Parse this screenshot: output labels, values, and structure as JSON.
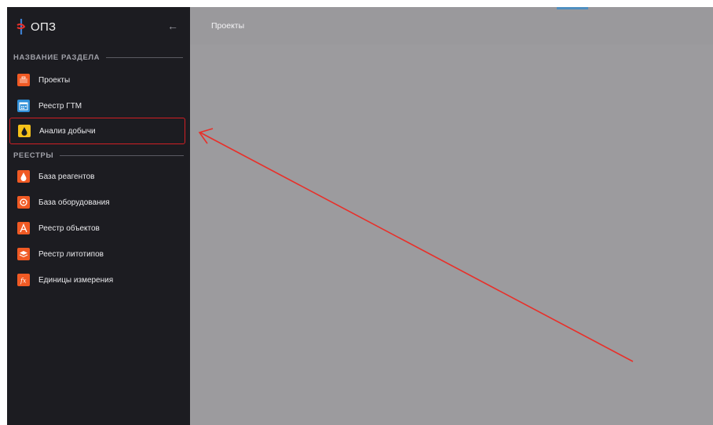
{
  "app": {
    "title": "ОПЗ",
    "collapse_icon": "arrow-left-icon"
  },
  "header": {
    "breadcrumb": "Проекты"
  },
  "sidebar": {
    "sections": [
      {
        "title": "НАЗВАНИЕ РАЗДЕЛА",
        "items": [
          {
            "label": "Проекты",
            "icon": "briefcase-icon",
            "color": "#f05a24"
          },
          {
            "label": "Реестр ГТМ",
            "icon": "calendar-icon",
            "color": "#2f8fd8"
          },
          {
            "label": "Анализ добычи",
            "icon": "oil-drop-icon",
            "color": "#f6c21a",
            "highlighted": true
          }
        ]
      },
      {
        "title": "РЕЕСТРЫ",
        "items": [
          {
            "label": "База реагентов",
            "icon": "drop-icon",
            "color": "#f05a24"
          },
          {
            "label": "База оборудования",
            "icon": "gauge-icon",
            "color": "#f05a24"
          },
          {
            "label": "Реестр объектов",
            "icon": "letter-a-icon",
            "color": "#f05a24"
          },
          {
            "label": "Реестр литотипов",
            "icon": "layers-icon",
            "color": "#f05a24"
          },
          {
            "label": "Единицы измерения",
            "icon": "function-icon",
            "color": "#f05a24"
          }
        ]
      }
    ]
  },
  "annotation": {
    "color": "#e8302a"
  }
}
